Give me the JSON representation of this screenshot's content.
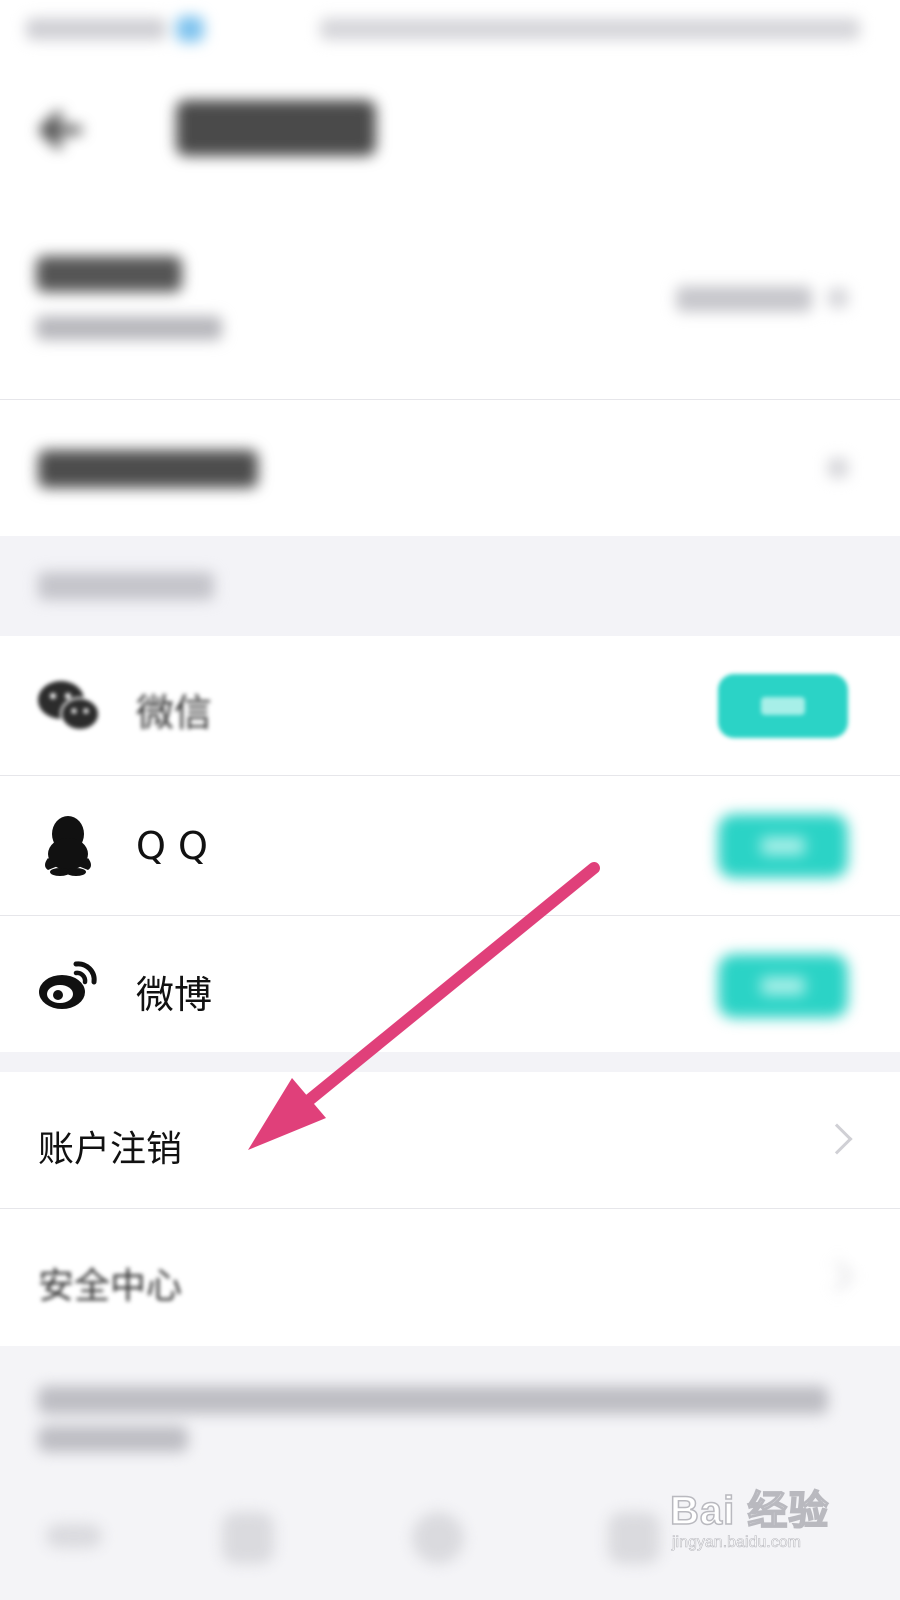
{
  "accounts": [
    {
      "name": "微信",
      "icon": "wechat-icon"
    },
    {
      "name": "Q Q",
      "icon": "qq-icon"
    },
    {
      "name": "微博",
      "icon": "weibo-icon"
    }
  ],
  "menu": {
    "cancel_account": "账户注销",
    "security_center": "安全中心"
  },
  "watermark": {
    "brand": "Bai 经验",
    "url": "jingyan.baidu.com"
  },
  "colors": {
    "bind_button": "#2bd3c6",
    "annotation_arrow": "#e0407a",
    "section_background": "#f3f3f7"
  }
}
